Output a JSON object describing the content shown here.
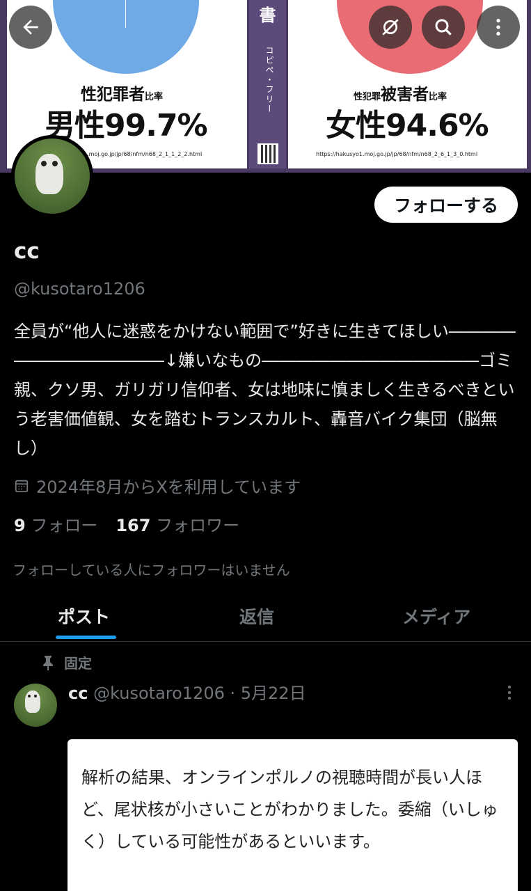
{
  "banner": {
    "spine_title": "書",
    "spine_sub": "コピペ・フリー",
    "left_label_a": "性犯罪者",
    "left_label_b": "比率",
    "left_value": "男性99.7%",
    "left_url": "1.moj.go.jp/jp/68/nfm/n68_2_1_1_2_2.html",
    "right_label_a": "性犯罪",
    "right_label_b": "被害者",
    "right_label_c": "比率",
    "right_value": "女性94.6%",
    "right_url": "https://hakusyo1.moj.go.jp/jp/68/nfm/n68_2_6_1_3_0.html",
    "colors": {
      "male_pie": "#6fa9e6",
      "female_pie": "#e96b73"
    },
    "icons": [
      "back-arrow-icon",
      "hide-icon",
      "search-icon",
      "more-vertical-icon"
    ]
  },
  "profile": {
    "follow_label": "フォローする",
    "display_name": "cc",
    "handle": "@kusotaro1206",
    "bio": "全員が“他人に迷惑をかけない範囲で”好きに生きてほしい―――――――――――――↓嫌いなもの―――――――――――――ゴミ親、クソ男、ガリガリ信仰者、女は地味に慎ましく生きるべきという老害価値観、女を踏むトランスカルト、轟音バイク集団（脳無し）",
    "joined": "2024年8月からXを利用しています",
    "following_count": "9",
    "following_label": "フォロー",
    "followers_count": "167",
    "followers_label": "フォロワー",
    "known_followers": "フォローしている人にフォロワーはいません"
  },
  "tabs": [
    "ポスト",
    "返信",
    "メディア"
  ],
  "post": {
    "pinned_label": "固定",
    "name": "cc",
    "handle_date": "@kusotaro1206 · 5月22日",
    "quote_text": "解析の結果、オンラインポルノの視聴時間が長い人ほど、尾状核が小さいことがわかりました。委縮（いしゅく）している可能性があるといいます。"
  },
  "colors": {
    "accent": "#1d9bf0",
    "background": "#000000",
    "muted_text": "#71767b"
  }
}
